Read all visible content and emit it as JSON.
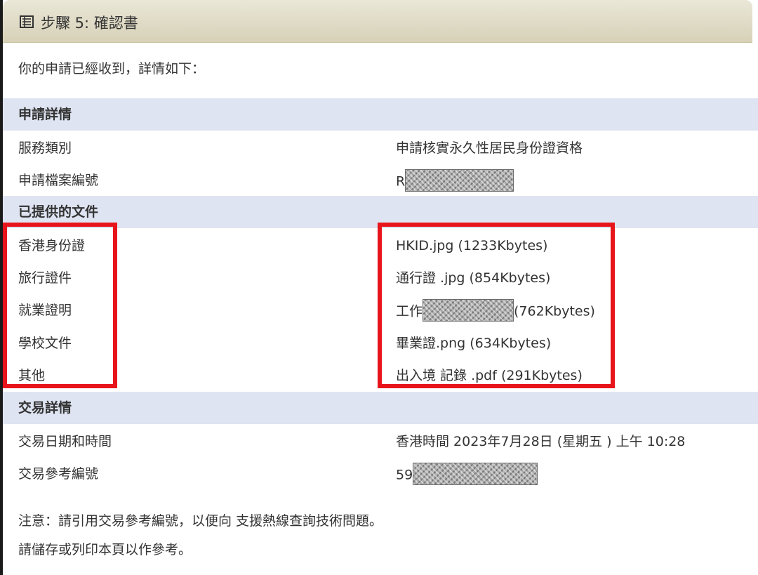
{
  "header": {
    "icon": "list-document-icon",
    "title": "步驟 5: 確認書"
  },
  "intro": "你的申請已經收到，詳情如下：",
  "application_details": {
    "heading": "申請詳情",
    "rows": [
      {
        "label": "服務類別",
        "value": "申請核實永久性居民身份證資格"
      },
      {
        "label": "申請檔案編號",
        "value_prefix": "R"
      }
    ]
  },
  "documents": {
    "heading": "已提供的文件",
    "rows": [
      {
        "label": "香港身份證",
        "value": "HKID.jpg (1233Kbytes)"
      },
      {
        "label": "旅行證件",
        "value": "通行證 .jpg (854Kbytes)"
      },
      {
        "label": "就業證明",
        "value_prefix": "工作",
        "value_suffix": "(762Kbytes)"
      },
      {
        "label": "學校文件",
        "value": "畢業證.png (634Kbytes)"
      },
      {
        "label": "其他",
        "value": "出入境 記錄 .pdf (291Kbytes)"
      }
    ]
  },
  "transaction": {
    "heading": "交易詳情",
    "rows": [
      {
        "label": "交易日期和時間",
        "value": "香港時間 2023年7月28日 (星期五 ) 上午 10:28"
      },
      {
        "label": "交易參考編號",
        "value_prefix": "59"
      }
    ]
  },
  "notes": {
    "line1": "注意：請引用交易參考編號，以便向 支援熱線查詢技術問題。",
    "line2": "請儲存或列印本頁以作參考。"
  },
  "colors": {
    "header_bg": "#dcd7bf",
    "section_band": "#dfe4f2",
    "highlight_box": "#e8141b",
    "text": "#333333"
  }
}
